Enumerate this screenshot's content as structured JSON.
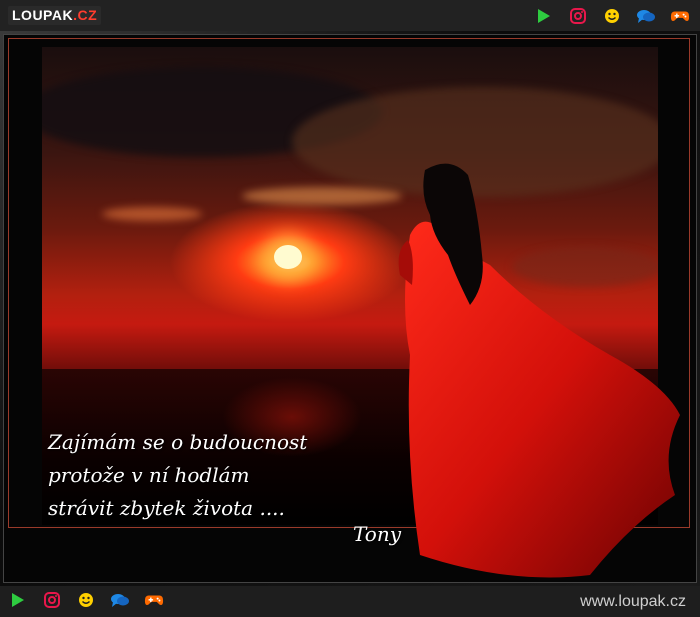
{
  "header": {
    "logo_main": "LOUPAK",
    "logo_suffix": ".CZ"
  },
  "icons": [
    "play-icon",
    "instagram-icon",
    "smiley-icon",
    "chat-icon",
    "gamepad-icon"
  ],
  "colors": {
    "play": "#2ecc40",
    "instagram": "#e8174b",
    "smiley": "#ffd000",
    "chat": "#1e88e5",
    "gamepad": "#ff6a00"
  },
  "poem": {
    "line1": "Zajímám se  o budoucnost",
    "line2": "protože v ní hodlám",
    "line3": "strávit zbytek života ....",
    "signature": "Tony"
  },
  "footer": {
    "site": "www.loupak.cz"
  }
}
